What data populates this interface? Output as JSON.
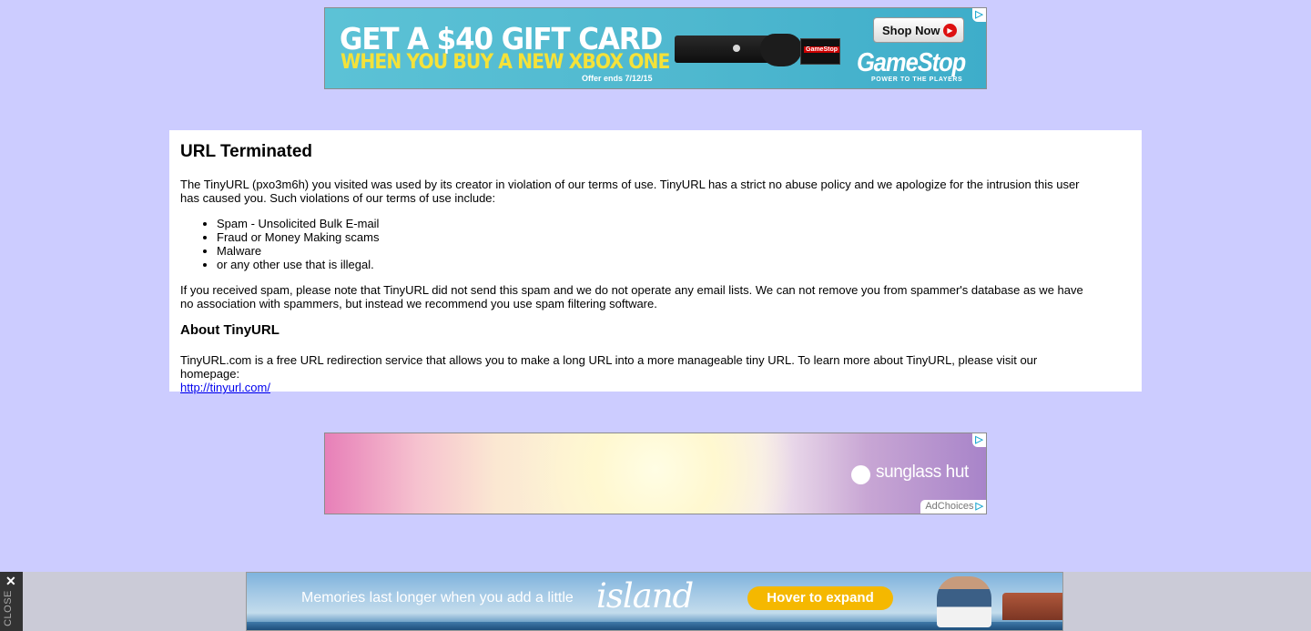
{
  "ads": {
    "top": {
      "headline": "GET A $40 GIFT CARD",
      "subheadline": "WHEN YOU BUY A NEW XBOX ONE",
      "offer_note": "Offer ends 7/12/15",
      "card_label": "GameStop",
      "cta": "Shop Now",
      "brand": "GameStop",
      "tagline": "POWER TO THE PLAYERS",
      "colors": {
        "background": "#4fb8cf",
        "subheadline": "#f4e23a"
      }
    },
    "middle": {
      "brand": "sunglass hut",
      "adchoices_label": "AdChoices"
    },
    "bottom": {
      "message": "Memories last longer when you add a little",
      "brand_word": "island",
      "cta": "Hover to expand",
      "close_label": "CLOSE",
      "colors": {
        "cta": "#f5b800"
      }
    }
  },
  "notice": {
    "title": "URL Terminated",
    "intro": "The TinyURL (pxo3m6h) you visited was used by its creator in violation of our terms of use. TinyURL has a strict no abuse policy and we apologize for the intrusion this user has caused you. Such violations of our terms of use include:",
    "violations": [
      "Spam - Unsolicited Bulk E-mail",
      "Fraud or Money Making scams",
      "Malware",
      "or any other use that is illegal."
    ],
    "spam_note": "If you received spam, please note that TinyURL did not send this spam and we do not operate any email lists. We can not remove you from spammer's database as we have no association with spammers, but instead we recommend you use spam filtering software.",
    "about_heading": "About TinyURL",
    "about_text": "TinyURL.com is a free URL redirection service that allows you to make a long URL into a more manageable tiny URL. To learn more about TinyURL, please visit our homepage:",
    "homepage_link": "http://tinyurl.com/"
  },
  "colors": {
    "page_background": "#ccccff",
    "link": "#0000ee"
  }
}
